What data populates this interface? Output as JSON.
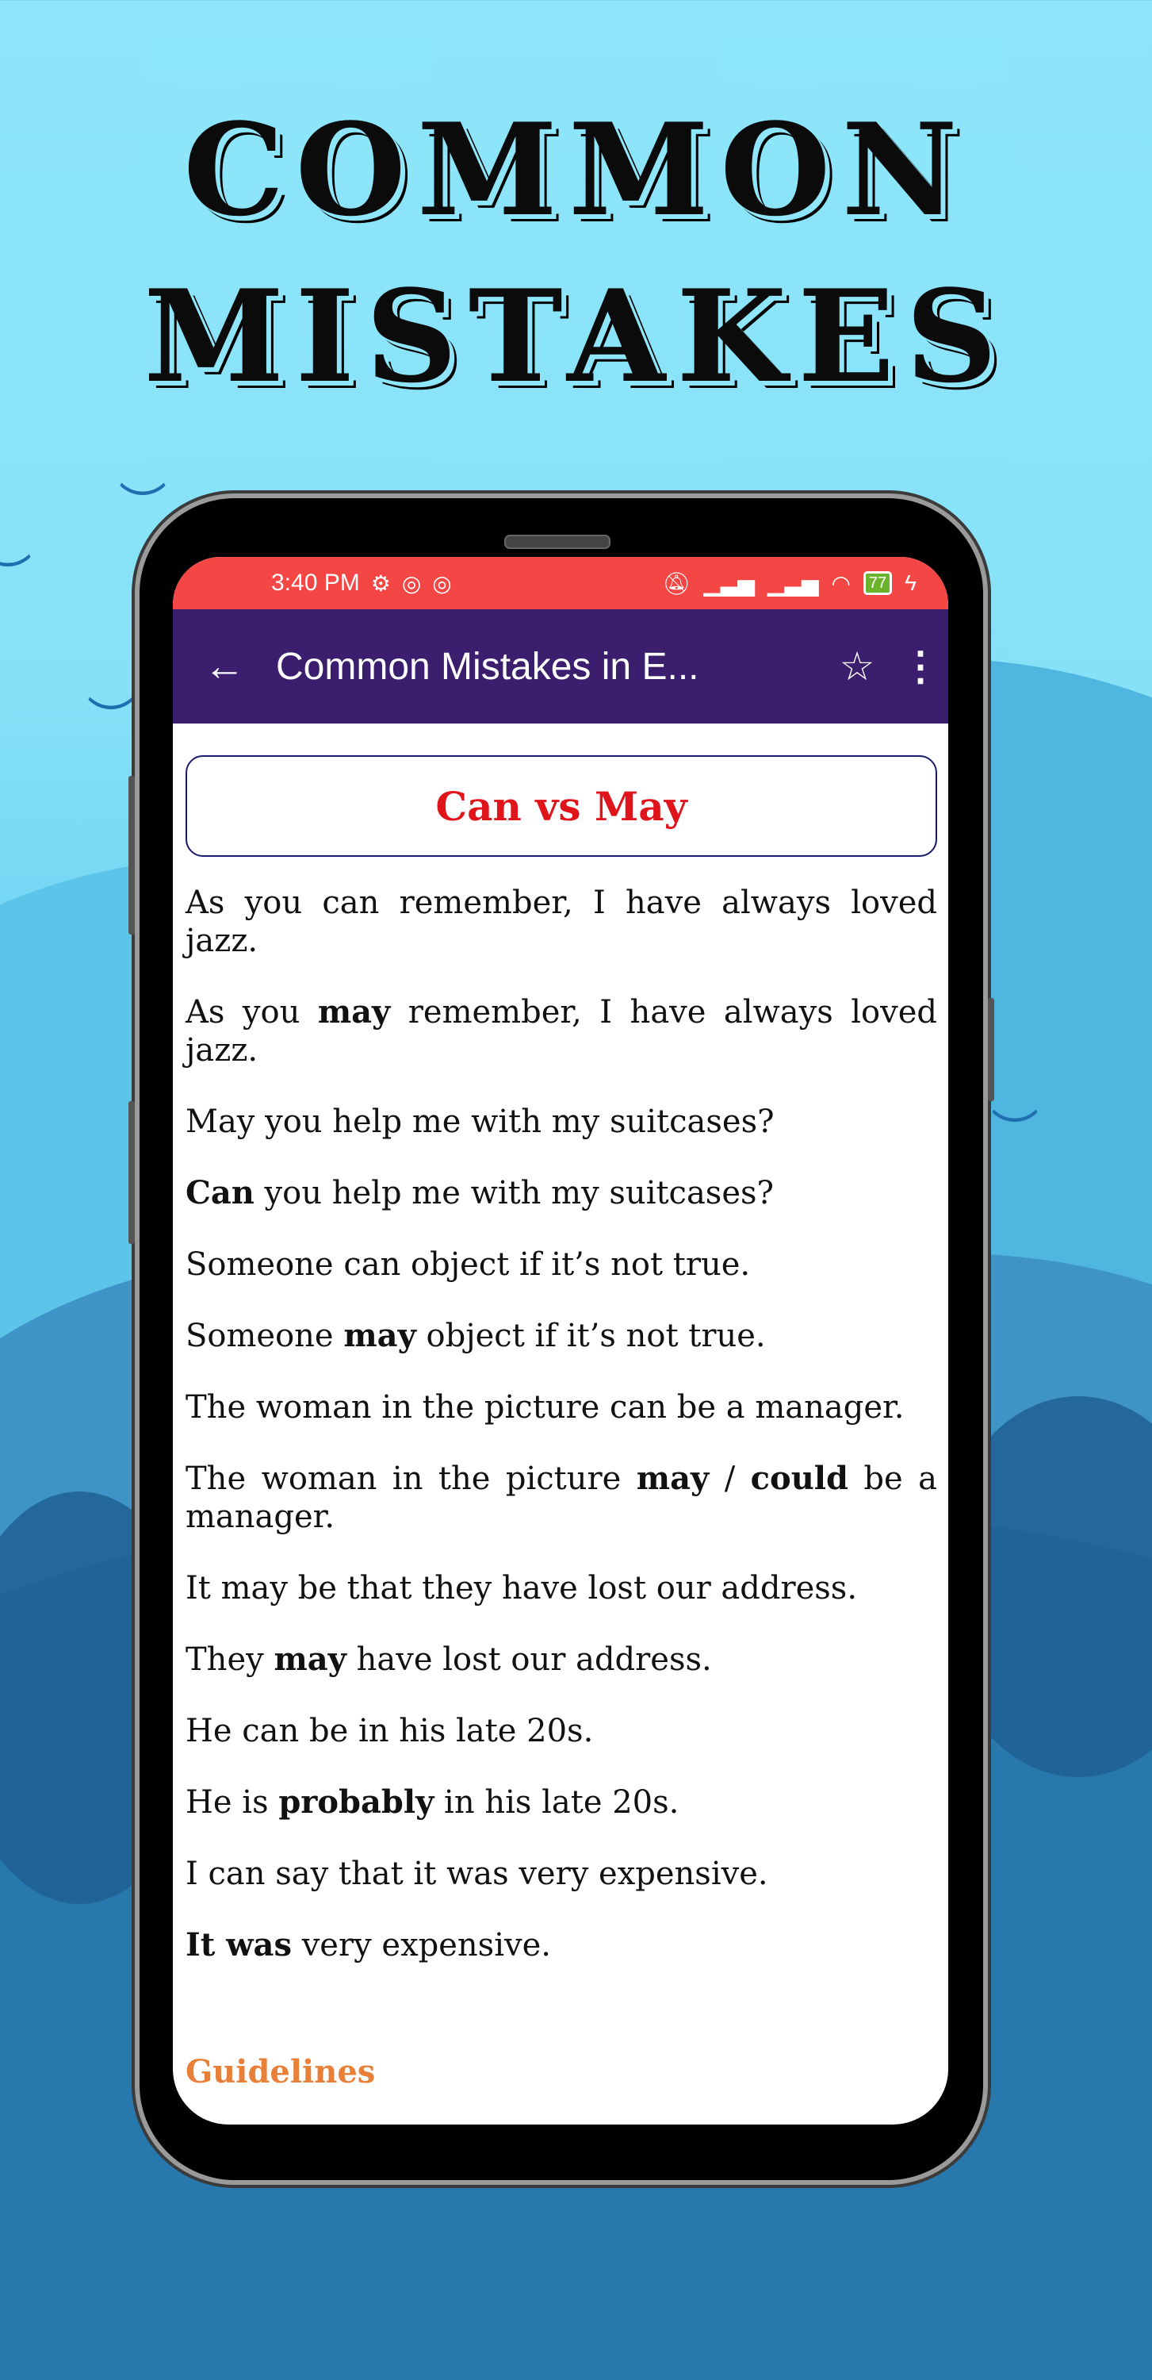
{
  "headline": {
    "line1": "COMMON",
    "line2": "MISTAKES"
  },
  "status_bar": {
    "time": "3:40 PM",
    "left_icons": [
      "gear-icon",
      "app-notification-icon",
      "app-notification-icon"
    ],
    "right_icons": [
      "bell-off-icon",
      "signal-icon",
      "signal-icon",
      "wifi-icon"
    ],
    "battery_level": "77",
    "charging_icon": "bolt-icon",
    "color": "#f44645"
  },
  "app_bar": {
    "title": "Common Mistakes in E...",
    "back_icon": "←",
    "star_icon": "☆",
    "menu_icon": "⋮",
    "color": "#3b1e6d"
  },
  "content": {
    "topic_title": "Can vs May",
    "topic_color": "#e0141b",
    "paragraphs": [
      {
        "segments": [
          {
            "t": "As you can remember, I have always loved jazz.",
            "b": false
          }
        ]
      },
      {
        "segments": [
          {
            "t": "As you ",
            "b": false
          },
          {
            "t": "may",
            "b": true
          },
          {
            "t": " remember, I have always loved jazz.",
            "b": false
          }
        ]
      },
      {
        "segments": [
          {
            "t": "May you help me with my suitcases?",
            "b": false
          }
        ]
      },
      {
        "segments": [
          {
            "t": "Can",
            "b": true
          },
          {
            "t": " you help me with my suitcases?",
            "b": false
          }
        ]
      },
      {
        "segments": [
          {
            "t": "Someone can object if it’s not true.",
            "b": false
          }
        ]
      },
      {
        "segments": [
          {
            "t": "Someone ",
            "b": false
          },
          {
            "t": "may",
            "b": true
          },
          {
            "t": " object if it’s not true.",
            "b": false
          }
        ]
      },
      {
        "segments": [
          {
            "t": "The woman in the picture can be a manager.",
            "b": false
          }
        ]
      },
      {
        "segments": [
          {
            "t": "The woman in the picture ",
            "b": false
          },
          {
            "t": "may",
            "b": true
          },
          {
            "t": " / ",
            "b": false
          },
          {
            "t": "could",
            "b": true
          },
          {
            "t": " be a manager.",
            "b": false
          }
        ]
      },
      {
        "segments": [
          {
            "t": "It may be that they have lost our address.",
            "b": false
          }
        ]
      },
      {
        "segments": [
          {
            "t": "They ",
            "b": false
          },
          {
            "t": "may",
            "b": true
          },
          {
            "t": " have lost our address.",
            "b": false
          }
        ]
      },
      {
        "segments": [
          {
            "t": "He can be in his late 20s.",
            "b": false
          }
        ]
      },
      {
        "segments": [
          {
            "t": "He is ",
            "b": false
          },
          {
            "t": "probably",
            "b": true
          },
          {
            "t": " in his late 20s.",
            "b": false
          }
        ]
      },
      {
        "segments": [
          {
            "t": "I can say that it was very expensive.",
            "b": false
          }
        ]
      },
      {
        "segments": [
          {
            "t": "It was",
            "b": true
          },
          {
            "t": " very expensive.",
            "b": false
          }
        ]
      }
    ],
    "section_heading": "Guidelines",
    "section_heading_color": "#e8803a"
  }
}
